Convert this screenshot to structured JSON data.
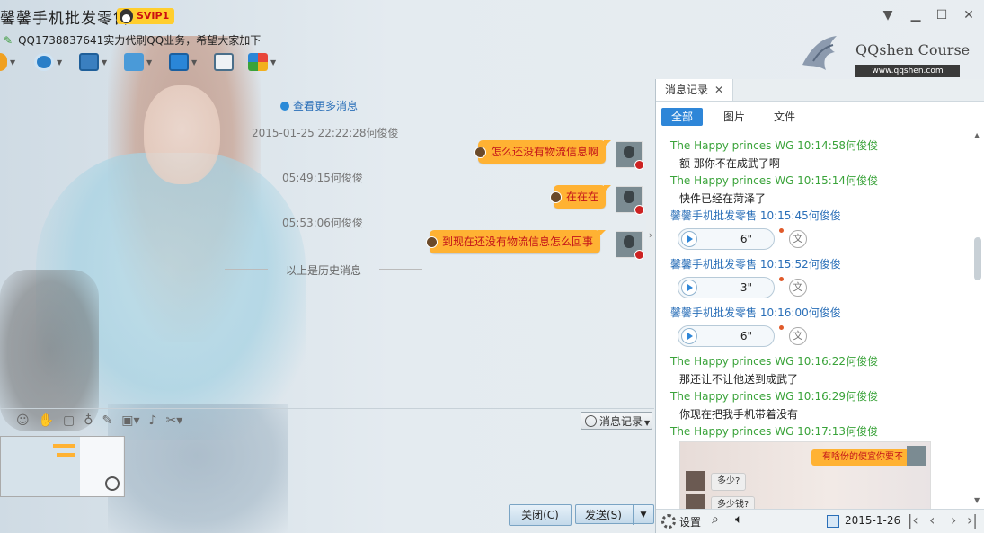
{
  "window": {
    "title": "馨馨手机批发零售",
    "vip_badge": "SVIP1",
    "signature": "QQ1738837641实力代刷QQ业务，希望大家加下"
  },
  "logo": {
    "text": "QQshen Course",
    "url": "www.qqshen.com"
  },
  "chat": {
    "more_link": "查看更多消息",
    "messages": [
      {
        "time": "2015-01-25 22:22:28何俊俊",
        "text": "怎么还没有物流信息啊"
      },
      {
        "time": "05:49:15何俊俊",
        "text": "在在在"
      },
      {
        "time": "05:53:06何俊俊",
        "text": "到现在还没有物流信息怎么回事"
      }
    ],
    "history_divider": "以上是历史消息"
  },
  "input": {
    "history_button": "消息记录",
    "close_button": "关闭(C)",
    "send_button": "发送(S)"
  },
  "record_panel": {
    "tab_label": "消息记录",
    "filters": [
      "全部",
      "图片",
      "文件"
    ],
    "records": [
      {
        "header": "The Happy princes  WG 10:14:58何俊俊",
        "color": "green",
        "body": "额  那你不在成武了啊"
      },
      {
        "header": "The Happy princes  WG 10:15:14何俊俊",
        "color": "green",
        "body": "快件已经在菏泽了"
      },
      {
        "header": "馨馨手机批发零售 10:15:45何俊俊",
        "color": "blue",
        "voice": "6\""
      },
      {
        "header": "馨馨手机批发零售 10:15:52何俊俊",
        "color": "blue",
        "voice": "3\""
      },
      {
        "header": "馨馨手机批发零售 10:16:00何俊俊",
        "color": "blue",
        "voice": "6\""
      },
      {
        "header": "The Happy princes  WG 10:16:22何俊俊",
        "color": "green",
        "body": "那还让不让他送到成武了"
      },
      {
        "header": "The Happy princes  WG 10:16:29何俊俊",
        "color": "green",
        "body": "你现在把我手机带着没有"
      },
      {
        "header": "The Happy princes  WG 10:17:13何俊俊",
        "color": "green"
      }
    ],
    "image_preview": {
      "bubble": "有啥份的便宜你要不",
      "q1": "多少?",
      "q2": "多少钱?"
    },
    "voice_translate": "文",
    "footer": {
      "settings": "设置",
      "date": "2015-1-26"
    }
  }
}
